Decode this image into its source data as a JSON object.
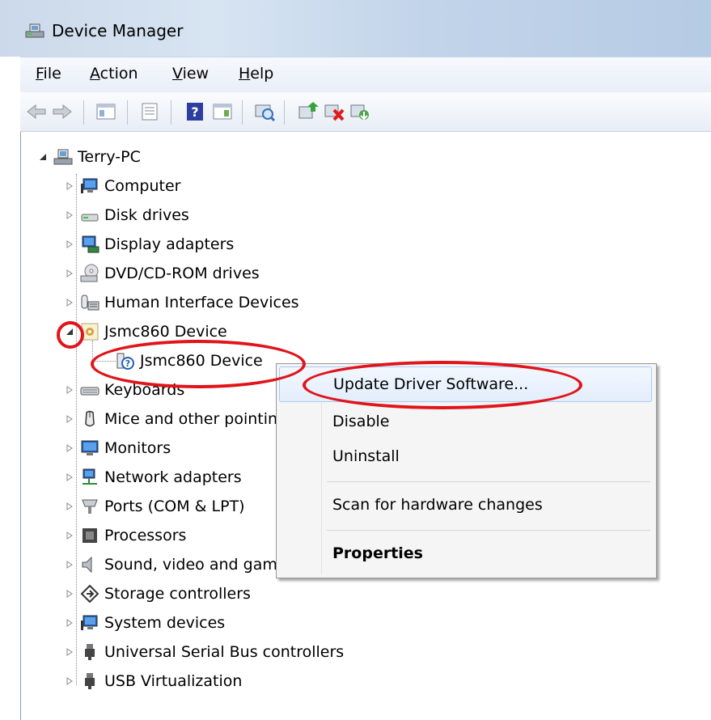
{
  "window": {
    "title": "Device Manager",
    "icon": "device-manager-icon"
  },
  "menu": [
    {
      "label": "File",
      "accel": "F",
      "rest": "ile"
    },
    {
      "label": "Action",
      "accel": "A",
      "rest": "ction"
    },
    {
      "label": "View",
      "accel": "V",
      "rest": "iew"
    },
    {
      "label": "Help",
      "accel": "H",
      "rest": "elp"
    }
  ],
  "toolbar": [
    "back-icon",
    "forward-icon",
    "show-hide-console-tree-icon",
    "properties-icon",
    "help-icon",
    "show-action-pane-icon",
    "scan-hardware-icon",
    "update-driver-icon",
    "disable-device-icon",
    "uninstall-device-icon"
  ],
  "tree": {
    "root": "Terry-PC",
    "items": [
      {
        "label": "Computer",
        "icon": "computer-icon"
      },
      {
        "label": "Disk drives",
        "icon": "disk-drive-icon"
      },
      {
        "label": "Display adapters",
        "icon": "display-adapter-icon"
      },
      {
        "label": "DVD/CD-ROM drives",
        "icon": "dvd-drive-icon"
      },
      {
        "label": "Human Interface Devices",
        "icon": "hid-icon"
      },
      {
        "label": "Jsmc860 Device",
        "icon": "device-category-icon",
        "expanded": true,
        "children": [
          {
            "label": "Jsmc860 Device",
            "icon": "unknown-device-icon"
          }
        ]
      },
      {
        "label": "Keyboards",
        "icon": "keyboard-icon"
      },
      {
        "label": "Mice and other pointing devices",
        "icon": "mouse-icon"
      },
      {
        "label": "Monitors",
        "icon": "monitor-icon"
      },
      {
        "label": "Network adapters",
        "icon": "network-adapter-icon"
      },
      {
        "label": "Ports (COM & LPT)",
        "icon": "port-icon"
      },
      {
        "label": "Processors",
        "icon": "processor-icon"
      },
      {
        "label": "Sound, video and game controllers",
        "icon": "sound-icon"
      },
      {
        "label": "Storage controllers",
        "icon": "storage-controller-icon"
      },
      {
        "label": "System devices",
        "icon": "system-device-icon"
      },
      {
        "label": "Universal Serial Bus controllers",
        "icon": "usb-icon"
      },
      {
        "label": "USB Virtualization",
        "icon": "usb-icon"
      }
    ]
  },
  "context_menu": {
    "items": [
      {
        "label": "Update Driver Software...",
        "highlighted": true
      },
      {
        "label": "Disable"
      },
      {
        "label": "Uninstall"
      },
      {
        "label": "Scan for hardware changes"
      },
      {
        "label": "Properties",
        "bold": true
      }
    ]
  },
  "colors": {
    "annotation": "#e0141a",
    "highlight_border": "#aacbf1"
  }
}
